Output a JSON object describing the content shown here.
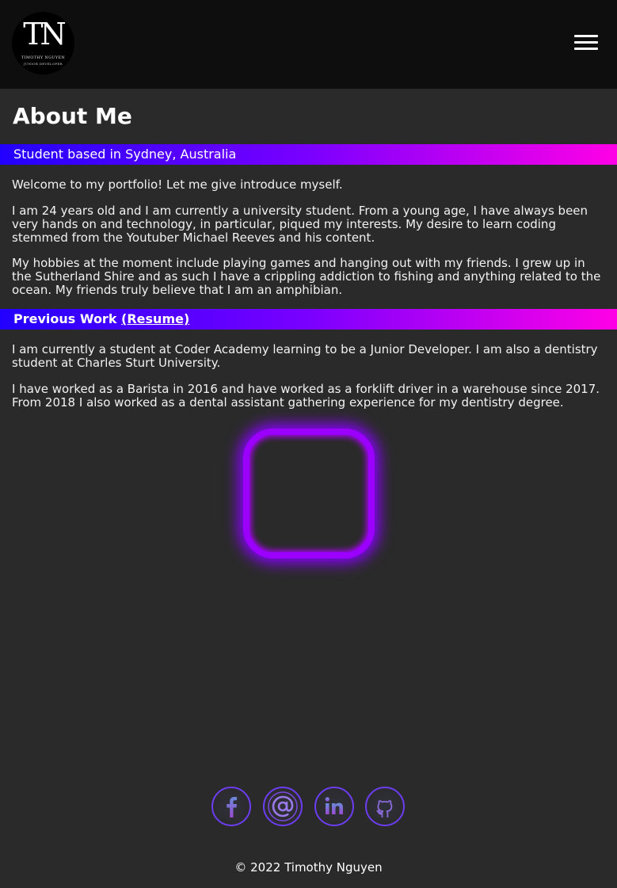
{
  "header": {
    "logo_monogram": "TN",
    "logo_name": "TIMOTHY NGUYEN",
    "logo_tagline": "JUNIOR DEVELOPER"
  },
  "main": {
    "title": "About Me",
    "band1": "Student based in Sydney, Australia",
    "about_paragraphs": [
      "Welcome to my portfolio! Let me give introduce myself.",
      "I am 24 years old and I am currently a university student. From a young age, I have always been very hands on and technology, in particular, piqued my interests. My desire to learn coding stemmed from the Youtuber Michael Reeves and his content.",
      "My hobbies at the moment include playing games and hanging out with my friends. I grew up in the Sutherland Shire and as such I have a crippling addiction to fishing and anything related to the ocean. My friends truly believe that I am an amphibian."
    ],
    "band2_label": "Previous Work",
    "band2_link": "(Resume)",
    "work_paragraphs": [
      "I am currently a student at Coder Academy learning to be a Junior Developer. I am also a dentistry student at Charles Sturt University.",
      "I have worked as a Barista in 2016 and have worked as a forklift driver in a warehouse since 2017. From 2018 I also worked as a dental assistant gathering experience for my dentistry degree."
    ]
  },
  "social": {
    "icons": [
      "facebook-icon",
      "email-icon",
      "linkedin-icon",
      "github-icon"
    ]
  },
  "footer": {
    "copyright": "© 2022 Timothy Nguyen"
  },
  "colors": {
    "header_bg": "#0e0e0e",
    "page_bg": "#2a2a2a",
    "gradient_start": "#2200ff",
    "gradient_end": "#ff00e6",
    "glow": "#9b00ff"
  }
}
